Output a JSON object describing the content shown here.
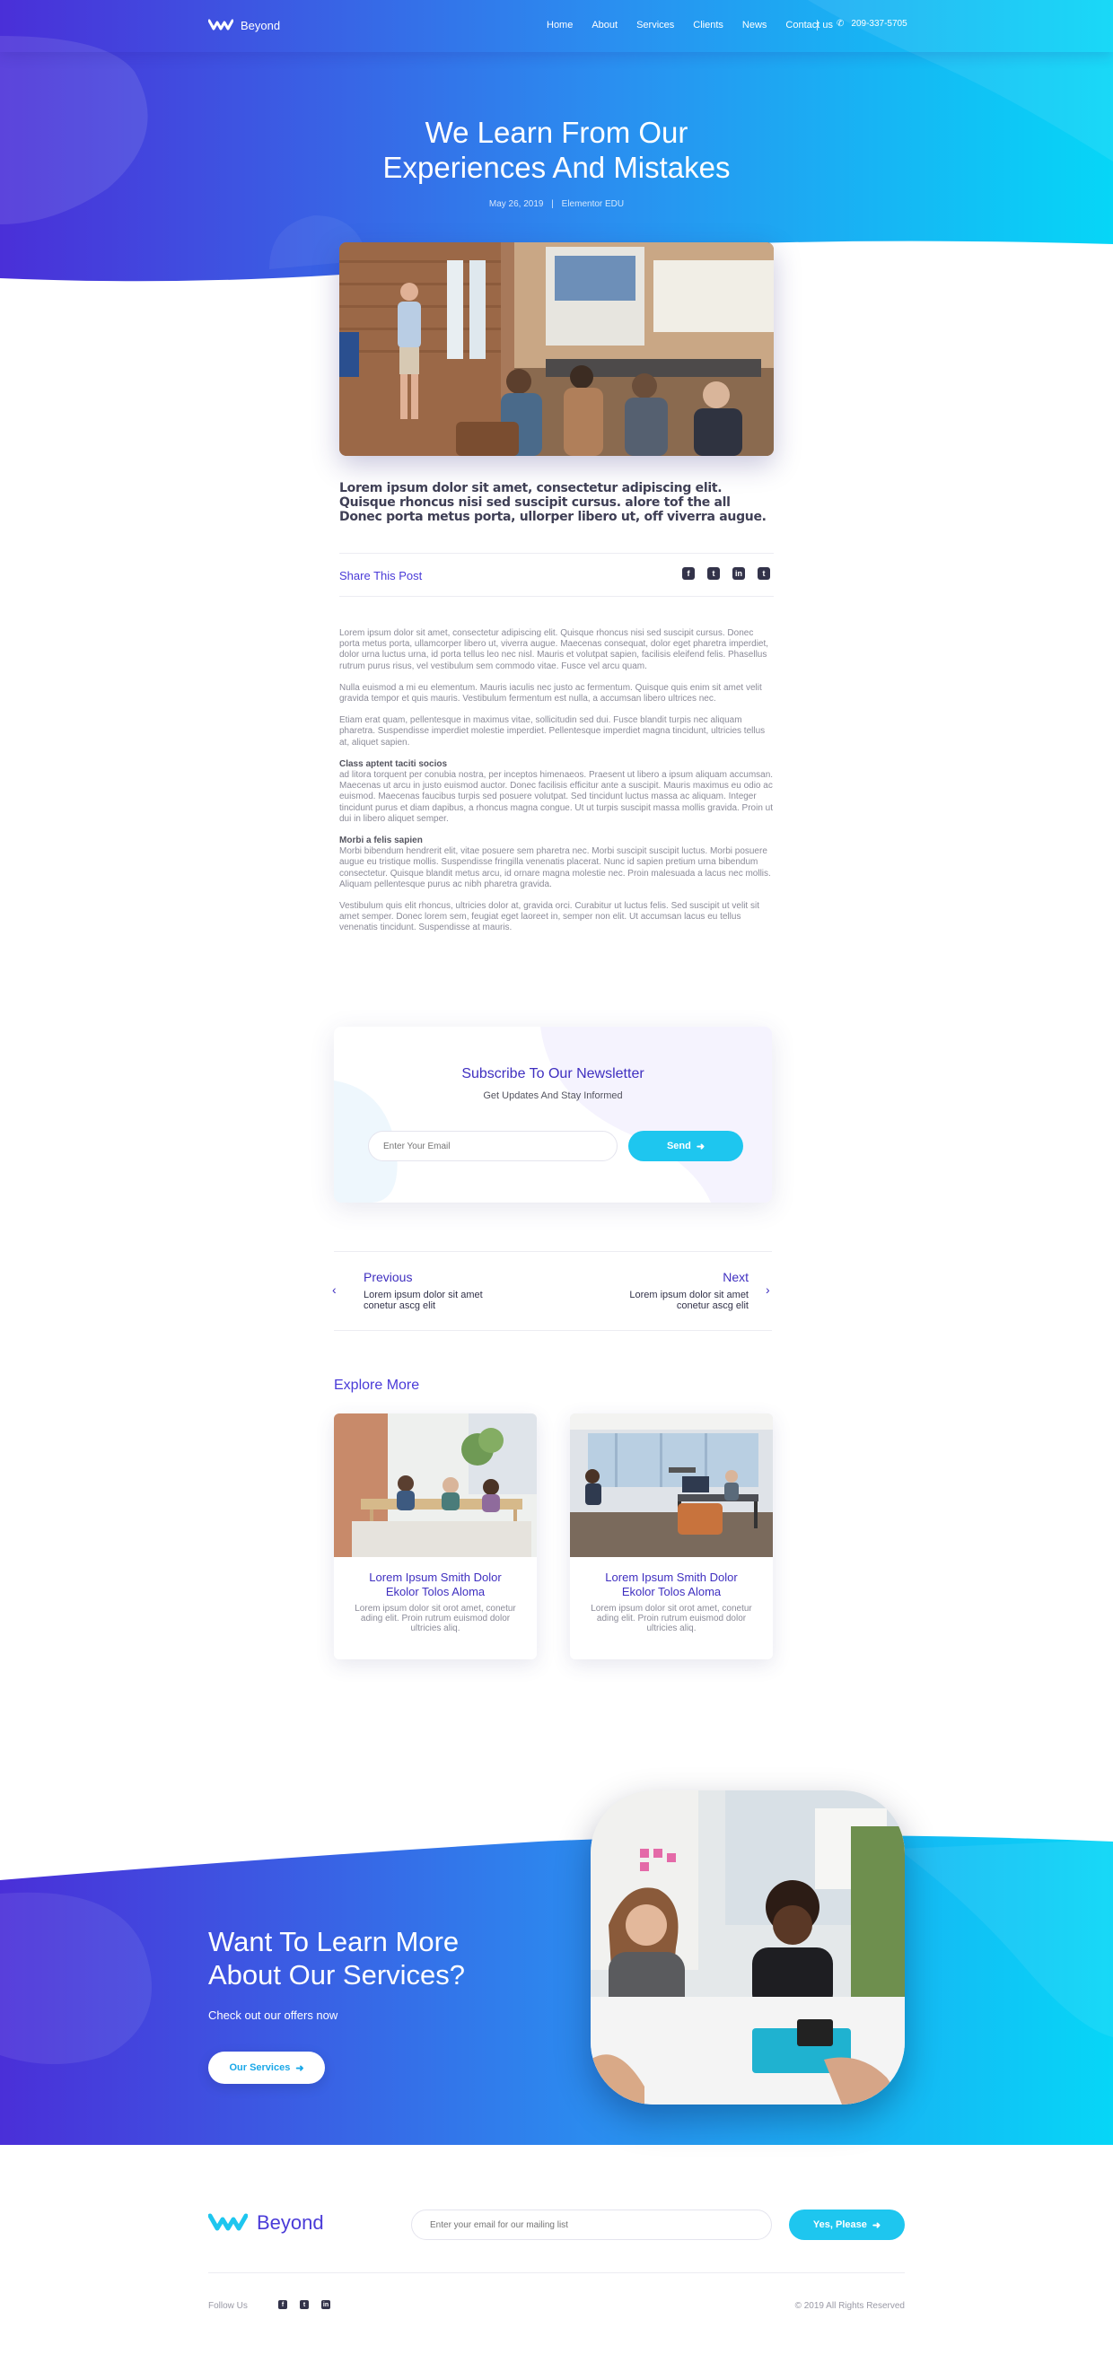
{
  "brand": {
    "name": "Beyond"
  },
  "nav": {
    "items": [
      {
        "label": "Home"
      },
      {
        "label": "About"
      },
      {
        "label": "Services"
      },
      {
        "label": "Clients"
      },
      {
        "label": "News"
      },
      {
        "label": "Contact us"
      }
    ],
    "phone": "209-337-5705"
  },
  "hero": {
    "title_line1": "We Learn From Our",
    "title_line2": "Experiences And Mistakes",
    "date": "May 26, 2019",
    "separator": "|",
    "author": "Elementor EDU"
  },
  "article": {
    "lead": "Lorem ipsum dolor sit amet, consectetur adipiscing elit. Quisque rhoncus nisi sed suscipit cursus. alore tof the all Donec porta metus porta, ullorper libero ut, off viverra augue.",
    "share_label": "Share This Post",
    "share_icons": [
      "facebook-icon",
      "twitter-icon",
      "linkedin-icon",
      "twitter-icon"
    ],
    "p1": "Lorem ipsum dolor sit amet, consectetur adipiscing elit. Quisque rhoncus nisi sed suscipit cursus. Donec porta metus porta, ullamcorper libero ut, viverra augue. Maecenas consequat, dolor eget pharetra imperdiet, dolor urna luctus urna, id porta tellus leo nec nisl. Mauris et volutpat sapien, facilisis eleifend felis. Phasellus rutrum purus risus, vel vestibulum sem commodo vitae. Fusce vel arcu quam.",
    "p2": "Nulla euismod a mi eu elementum. Mauris iaculis nec justo ac fermentum. Quisque quis enim sit amet velit gravida tempor et quis mauris. Vestibulum fermentum est nulla, a accumsan libero ultrices nec.",
    "p3": "Etiam erat quam, pellentesque in maximus vitae, sollicitudin sed dui. Fusce blandit turpis nec aliquam pharetra. Suspendisse imperdiet molestie imperdiet. Pellentesque imperdiet magna tincidunt, ultricies tellus at, aliquet sapien.",
    "h1": "Class aptent taciti socios",
    "p4": " ad litora torquent per conubia nostra, per inceptos himenaeos. Praesent ut libero a ipsum aliquam accumsan. Maecenas ut arcu in justo euismod auctor. Donec facilisis efficitur ante a suscipit. Mauris maximus eu odio ac euismod. Maecenas faucibus turpis sed posuere volutpat. Sed tincidunt luctus massa ac aliquam. Integer tincidunt purus et diam dapibus, a rhoncus magna congue. Ut ut turpis suscipit massa mollis gravida. Proin ut dui in libero aliquet semper.",
    "h2": "Morbi a felis sapien",
    "p5": "Morbi bibendum hendrerit elit, vitae posuere sem pharetra nec. Morbi suscipit suscipit luctus. Morbi posuere augue eu tristique mollis. Suspendisse fringilla venenatis placerat. Nunc id sapien pretium urna bibendum consectetur. Quisque blandit metus arcu, id ornare magna molestie nec. Proin malesuada a lacus nec mollis. Aliquam pellentesque purus ac nibh pharetra gravida.",
    "p6": "Vestibulum quis elit rhoncus, ultricies dolor at, gravida orci. Curabitur ut luctus felis. Sed suscipit ut velit sit amet semper. Donec lorem sem, feugiat eget laoreet in, semper non elit. Ut accumsan lacus eu tellus venenatis tincidunt. Suspendisse at mauris."
  },
  "newsletter": {
    "title": "Subscribe To Our Newsletter",
    "subtitle": "Get Updates And Stay Informed",
    "placeholder": "Enter Your Email",
    "button": "Send"
  },
  "post_nav": {
    "prev_label": "Previous",
    "prev_text_1": "Lorem ipsum dolor sit amet",
    "prev_text_2": "conetur ascg elit",
    "next_label": "Next",
    "next_text_1": "Lorem ipsum dolor sit amet",
    "next_text_2": "conetur ascg elit"
  },
  "explore": {
    "title": "Explore More",
    "cards": [
      {
        "title_1": "Lorem Ipsum Smith Dolor",
        "title_2": "Ekolor Tolos Aloma",
        "text": "Lorem ipsum dolor sit orot amet, conetur ading elit. Proin rutrum euismod dolor ultricies aliq."
      },
      {
        "title_1": "Lorem Ipsum Smith Dolor",
        "title_2": "Ekolor Tolos Aloma",
        "text": "Lorem ipsum dolor sit orot amet, conetur ading elit. Proin rutrum euismod dolor ultricies aliq."
      }
    ]
  },
  "cta": {
    "title_1": "Want To Learn More",
    "title_2": "About Our Services?",
    "subtitle": "Check out our offers now",
    "button": "Our Services"
  },
  "footer": {
    "brand": "Beyond",
    "placeholder": "Enter your email for our mailing list",
    "button": "Yes, Please",
    "follow": "Follow Us",
    "social_icons": [
      "facebook-icon",
      "twitter-icon",
      "linkedin-icon"
    ],
    "copyright": "© 2019 All Rights Reserved"
  },
  "colors": {
    "primary": "#4a3bd8",
    "accent": "#1ec6ef",
    "gradient_start": "#4a2fd8",
    "gradient_end": "#06d6f7"
  }
}
